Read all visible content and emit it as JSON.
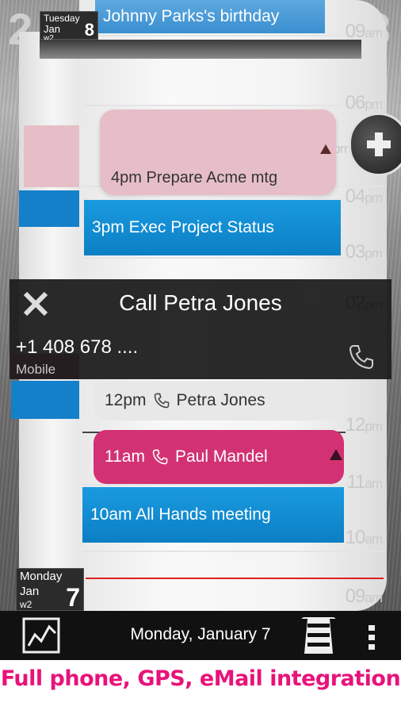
{
  "header": {
    "prev_day_number": "2",
    "next_day_number": "3",
    "top_date": {
      "weekday": "Tuesday",
      "month": "Jan",
      "week": "w2",
      "day": "8"
    }
  },
  "bottom_date": {
    "weekday": "Monday",
    "month": "Jan",
    "week": "w2",
    "day": "7"
  },
  "hour_labels": [
    {
      "hour": "09",
      "suffix": "am"
    },
    {
      "hour": "06",
      "suffix": "pm"
    },
    {
      "hour": "05",
      "suffix": "pm"
    },
    {
      "hour": "04",
      "suffix": "pm"
    },
    {
      "hour": "03",
      "suffix": "pm"
    },
    {
      "hour": "02",
      "suffix": "pm"
    },
    {
      "hour": "12",
      "suffix": "pm"
    },
    {
      "hour": "11",
      "suffix": "am"
    },
    {
      "hour": "10",
      "suffix": "am"
    },
    {
      "hour": "09",
      "suffix": "am"
    }
  ],
  "events": {
    "birthday": "Johnny Parks's birthday",
    "prepare": "4pm Prepare Acme mtg",
    "exec": "3pm Exec Project Status",
    "petra": {
      "time": "12pm",
      "name": "Petra Jones"
    },
    "paul": {
      "time": "11am",
      "name": "Paul Mandel"
    },
    "all_hands": "10am All Hands meeting"
  },
  "call_panel": {
    "title": "Call Petra Jones",
    "number": "+1 408 678 ....",
    "type": "Mobile"
  },
  "bottom_bar": {
    "title": "Monday, January 7"
  },
  "promo": "Full phone, GPS, eMail integration",
  "colors": {
    "blue_event": "#1a9ae0",
    "pink_event": "#e6bec7",
    "hot_pink_event": "#d23274",
    "promo_text": "#e8127a",
    "now_red": "#e02020"
  },
  "icons": [
    "plus-icon",
    "close-icon",
    "phone-icon",
    "chart-icon",
    "roller-icon",
    "overflow-menu-icon"
  ]
}
